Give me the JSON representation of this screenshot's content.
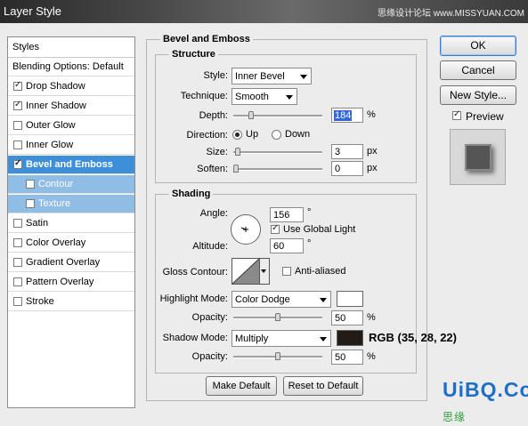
{
  "window": {
    "title": "Layer Style",
    "watermark": "思缘设计论坛 www.MISSYUAN.COM"
  },
  "styles_panel": {
    "header": "Styles",
    "blending_options": "Blending Options: Default",
    "items": [
      {
        "label": "Drop Shadow",
        "checked": true
      },
      {
        "label": "Inner Shadow",
        "checked": true
      },
      {
        "label": "Outer Glow",
        "checked": false
      },
      {
        "label": "Inner Glow",
        "checked": false
      },
      {
        "label": "Bevel and Emboss",
        "checked": true,
        "selected": true
      },
      {
        "label": "Contour",
        "checked": false,
        "sub": true
      },
      {
        "label": "Texture",
        "checked": false,
        "sub": true
      },
      {
        "label": "Satin",
        "checked": false
      },
      {
        "label": "Color Overlay",
        "checked": false
      },
      {
        "label": "Gradient Overlay",
        "checked": false
      },
      {
        "label": "Pattern Overlay",
        "checked": false
      },
      {
        "label": "Stroke",
        "checked": false
      }
    ]
  },
  "bevel": {
    "group_title": "Bevel and Emboss",
    "structure": {
      "title": "Structure",
      "style_label": "Style:",
      "style_value": "Inner Bevel",
      "technique_label": "Technique:",
      "technique_value": "Smooth",
      "depth_label": "Depth:",
      "depth_value": "184",
      "depth_unit": "%",
      "depth_slider_pct": 18,
      "direction_label": "Direction:",
      "direction_up": "Up",
      "direction_down": "Down",
      "direction_selected": "Up",
      "size_label": "Size:",
      "size_value": "3",
      "size_unit": "px",
      "size_slider_pct": 2,
      "soften_label": "Soften:",
      "soften_value": "0",
      "soften_unit": "px",
      "soften_slider_pct": 0
    },
    "shading": {
      "title": "Shading",
      "angle_label": "Angle:",
      "angle_value": "156",
      "angle_unit": "°",
      "use_global_light_label": "Use Global Light",
      "use_global_light_checked": true,
      "altitude_label": "Altitude:",
      "altitude_value": "60",
      "altitude_unit": "°",
      "gloss_contour_label": "Gloss Contour:",
      "anti_aliased_label": "Anti-aliased",
      "anti_aliased_checked": false,
      "highlight_mode_label": "Highlight Mode:",
      "highlight_mode_value": "Color Dodge",
      "highlight_color": "#ffffff",
      "highlight_opacity_label": "Opacity:",
      "highlight_opacity_value": "50",
      "highlight_opacity_unit": "%",
      "highlight_opacity_slider_pct": 50,
      "shadow_mode_label": "Shadow Mode:",
      "shadow_mode_value": "Multiply",
      "shadow_color": "#231c16",
      "shadow_rgb_note": "RGB (35, 28, 22)",
      "shadow_opacity_label": "Opacity:",
      "shadow_opacity_value": "50",
      "shadow_opacity_unit": "%",
      "shadow_opacity_slider_pct": 50
    },
    "make_default_label": "Make Default",
    "reset_default_label": "Reset to Default"
  },
  "buttons": {
    "ok": "OK",
    "cancel": "Cancel",
    "new_style": "New Style...",
    "preview_label": "Preview",
    "preview_checked": true
  },
  "logo": {
    "brand": "UiBQ.CoM",
    "sub": "思缘"
  },
  "colors": {
    "accent": "#3c8fd8",
    "accent_light": "#8fbde6"
  }
}
